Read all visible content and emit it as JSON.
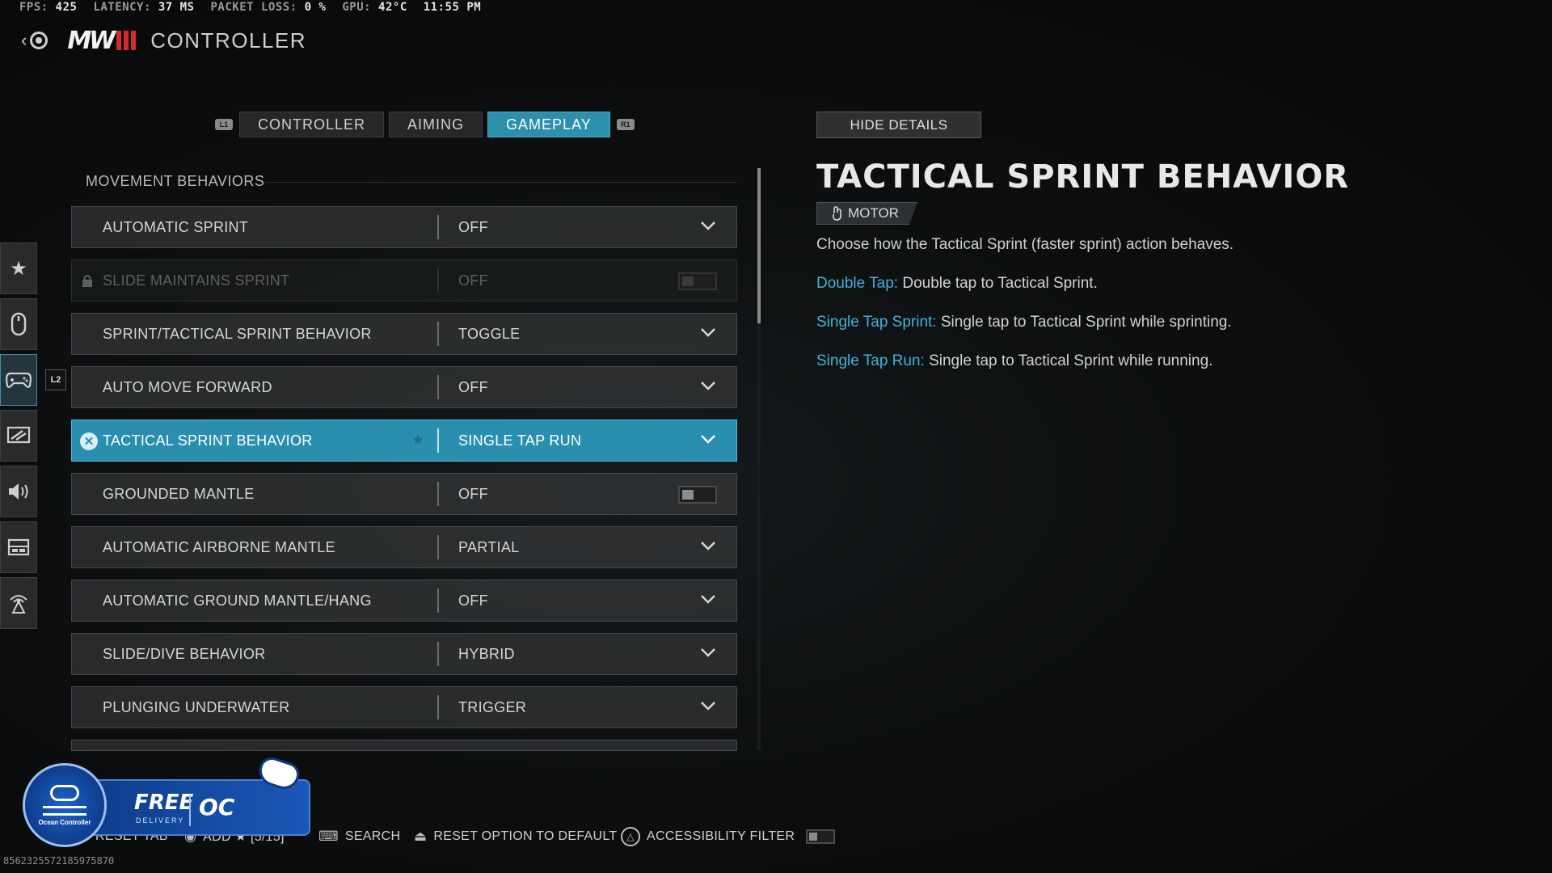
{
  "stats": {
    "fps_label": "FPS:",
    "fps": "425",
    "latency_label": "LATENCY:",
    "latency": "37 MS",
    "packet_label": "PACKET LOSS:",
    "packet": "0 %",
    "gpu_label": "GPU:",
    "gpu": "42°C",
    "time": "11:55 PM"
  },
  "header": {
    "title": "CONTROLLER",
    "logo_text": "MW"
  },
  "tabs": {
    "left_bumper": "L1",
    "right_bumper": "R1",
    "items": [
      {
        "label": "CONTROLLER"
      },
      {
        "label": "AIMING"
      },
      {
        "label": "GAMEPLAY",
        "active": true
      }
    ]
  },
  "sidebar": {
    "icons": [
      "star-icon",
      "mouse-icon",
      "gamepad-icon",
      "display-icon",
      "speaker-icon",
      "interface-icon",
      "network-icon"
    ],
    "active": "gamepad-icon",
    "tag": "L2"
  },
  "section": {
    "title": "MOVEMENT BEHAVIORS"
  },
  "settings": [
    {
      "label": "AUTOMATIC SPRINT",
      "value": "OFF",
      "control": "dropdown"
    },
    {
      "label": "SLIDE MAINTAINS SPRINT",
      "value": "OFF",
      "control": "toggle",
      "locked": true,
      "enabled": false
    },
    {
      "label": "SPRINT/TACTICAL SPRINT BEHAVIOR",
      "value": "TOGGLE",
      "control": "dropdown"
    },
    {
      "label": "AUTO MOVE FORWARD",
      "value": "OFF",
      "control": "dropdown"
    },
    {
      "label": "TACTICAL SPRINT BEHAVIOR",
      "value": "SINGLE TAP RUN",
      "control": "dropdown",
      "selected": true
    },
    {
      "label": "GROUNDED MANTLE",
      "value": "OFF",
      "control": "toggle",
      "enabled": false
    },
    {
      "label": "AUTOMATIC AIRBORNE MANTLE",
      "value": "PARTIAL",
      "control": "dropdown"
    },
    {
      "label": "AUTOMATIC GROUND MANTLE/HANG",
      "value": "OFF",
      "control": "dropdown"
    },
    {
      "label": "SLIDE/DIVE BEHAVIOR",
      "value": "HYBRID",
      "control": "dropdown"
    },
    {
      "label": "PLUNGING UNDERWATER",
      "value": "TRIGGER",
      "control": "dropdown"
    }
  ],
  "details": {
    "hide_label": "HIDE DETAILS",
    "title": "TACTICAL SPRINT BEHAVIOR",
    "tag": "MOTOR",
    "description": "Choose how the Tactical Sprint (faster sprint) action behaves.",
    "options": [
      {
        "term": "Double Tap:",
        "text": "Double tap to Tactical Sprint."
      },
      {
        "term": "Single Tap Sprint:",
        "text": "Single tap to Tactical Sprint while sprinting."
      },
      {
        "term": "Single Tap Run:",
        "text": "Single tap to Tactical Sprint while running."
      }
    ]
  },
  "banner": {
    "free": "FREE",
    "delivery": "DELIVERY",
    "oc": "OC",
    "brand": "Ocean Controller"
  },
  "footer": {
    "reset_tab": "RESET TAB",
    "add_favorite": "ADD ★ [5/15]",
    "search": "SEARCH",
    "reset_option": "RESET OPTION TO DEFAULT",
    "accessibility": "ACCESSIBILITY FILTER",
    "accessibility_enabled": false
  },
  "session_id": "8562325572185975870",
  "colors": {
    "accent": "#2d8fae",
    "link": "#3fb3de",
    "brand_red": "#d32a2a"
  }
}
